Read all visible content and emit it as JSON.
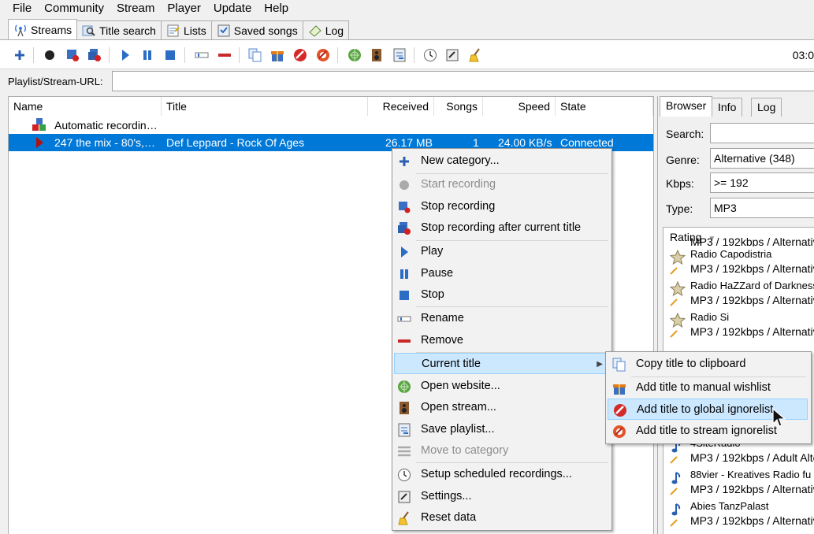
{
  "menubar": [
    "File",
    "Community",
    "Stream",
    "Player",
    "Update",
    "Help"
  ],
  "tabs": [
    {
      "label": "Streams",
      "icon": "antenna-icon",
      "active": true
    },
    {
      "label": "Title search",
      "icon": "search-icon"
    },
    {
      "label": "Lists",
      "icon": "list-icon"
    },
    {
      "label": "Saved songs",
      "icon": "saved-icon"
    },
    {
      "label": "Log",
      "icon": "log-icon"
    }
  ],
  "toolbar": {
    "clock": "03:0"
  },
  "url": {
    "label": "Playlist/Stream-URL:",
    "value": ""
  },
  "list": {
    "columns": [
      "Name",
      "Title",
      "Received",
      "Songs",
      "Speed",
      "State"
    ],
    "rows": [
      {
        "name": "Automatic recordin…",
        "title": "",
        "received": "",
        "songs": "",
        "speed": "",
        "state": "",
        "icon": "automatic-recording-icon"
      },
      {
        "name": "247 the mix - 80's,…",
        "title": "Def Leppard - Rock Of Ages",
        "received": "26.17 MB",
        "songs": "1",
        "speed": "24.00 KB/s",
        "state": "Connected",
        "icon": "recording-stream-icon"
      }
    ]
  },
  "right_panel": {
    "tabs": [
      "Browser",
      "Info",
      "Log"
    ],
    "search_label": "Search:",
    "search_value": "",
    "genre_label": "Genre:",
    "genre_value": "Alternative (348)",
    "kbps_label": "Kbps:",
    "kbps_value": ">= 192",
    "type_label": "Type:",
    "type_value": "MP3",
    "sort_label": "Rating",
    "stations": [
      {
        "name": "",
        "info": "MP3 / 192kbps / Alternativ",
        "icon": "star-icon"
      },
      {
        "name": "Radio Capodistria",
        "info": "MP3 / 192kbps / Alternativ",
        "icon": "star-icon"
      },
      {
        "name": "Radio HaZZard of Darkness",
        "info": "MP3 / 192kbps / Alternativ",
        "icon": "star-icon"
      },
      {
        "name": "Radio Si",
        "info": "MP3 / 192kbps / Alternativ",
        "icon": "star-icon"
      },
      {
        "name": "4SiteRadio",
        "info": "MP3 / 192kbps / Adult Alte",
        "icon": "music-note-icon"
      },
      {
        "name": "88vier - Kreatives Radio fu",
        "info": "MP3 / 192kbps / Alternativ",
        "icon": "music-note-icon"
      },
      {
        "name": "Abies TanzPalast",
        "info": "MP3 / 192kbps / Alternativ",
        "icon": "music-note-icon"
      }
    ]
  },
  "context_menu": [
    {
      "label": "New category...",
      "icon": "plus-icon"
    },
    {
      "label": "Start recording",
      "icon": "record-icon",
      "disabled": true
    },
    {
      "label": "Stop recording",
      "icon": "stop-recording-icon"
    },
    {
      "label": "Stop recording after current title",
      "icon": "stop-after-title-icon"
    },
    {
      "label": "Play",
      "icon": "play-icon"
    },
    {
      "label": "Pause",
      "icon": "pause-icon"
    },
    {
      "label": "Stop",
      "icon": "stop-icon"
    },
    {
      "label": "Rename",
      "icon": "rename-icon"
    },
    {
      "label": "Remove",
      "icon": "remove-icon"
    },
    {
      "label": "Current title",
      "icon": "",
      "submenu": true
    },
    {
      "label": "Open website...",
      "icon": "globe-icon"
    },
    {
      "label": "Open stream...",
      "icon": "speaker-icon"
    },
    {
      "label": "Save playlist...",
      "icon": "save-playlist-icon"
    },
    {
      "label": "Move to category",
      "icon": "category-icon",
      "disabled": true
    },
    {
      "label": "Setup scheduled recordings...",
      "icon": "clock-icon"
    },
    {
      "label": "Settings...",
      "icon": "settings-icon"
    },
    {
      "label": "Reset data",
      "icon": "broom-icon"
    }
  ],
  "submenu": [
    {
      "label": "Copy title to clipboard",
      "icon": "copy-icon"
    },
    {
      "label": "Add title to manual wishlist",
      "icon": "gift-icon"
    },
    {
      "label": "Add title to global ignorelist",
      "icon": "no-entry-icon",
      "highlighted": true
    },
    {
      "label": "Add title to stream ignorelist",
      "icon": "no-entry-stream-icon"
    }
  ],
  "colors": {
    "selection": "#0078d7",
    "menu_highlight": "#cce8ff",
    "accent": "#2b6cc4"
  }
}
